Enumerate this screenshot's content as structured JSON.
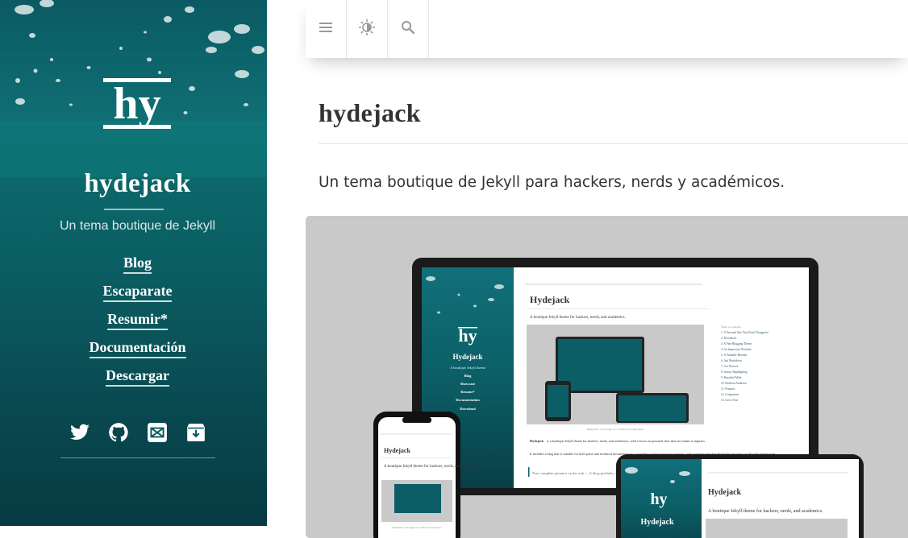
{
  "sidebar": {
    "logo_text": "hy",
    "title": "hydejack",
    "tagline": "Un tema boutique de Jekyll",
    "nav": [
      "Blog",
      "Escaparate",
      "Resumir*",
      "Documentación",
      "Descargar"
    ],
    "social_icons": [
      "twitter-icon",
      "github-icon",
      "email-icon",
      "download-icon"
    ]
  },
  "toolbar": {
    "icons": [
      "menu-icon",
      "theme-icon",
      "search-icon"
    ]
  },
  "main": {
    "title": "hydejack",
    "lead": "Un tema boutique de Jekyll para hackers, nerds y académicos."
  },
  "screenshot_mockup": {
    "laptop": {
      "sidebar_title": "Hydejack",
      "sidebar_tagline": "A boutique Jekyll theme",
      "sidebar_nav": [
        "Blog",
        "Showcase",
        "Resume*",
        "Documentation",
        "Download"
      ],
      "title": "Hydejack",
      "lead": "A boutique Jekyll theme for hackers, nerds, and academics.",
      "caption": "Hydejack's cover page on a variety of screen sizes.",
      "body_start": "Hydejack",
      "body_1": "is a boutique Jekyll theme for hackers, nerds, and academics, with a focus on personal sites that are meant to impress.",
      "body_2": "It includes a blog that is suitable for both prose and technical documentation, a portfolio to showcase your projects, and a resume template that looks amazing on the web and in print.",
      "quote": "Your complete presence on the web — A blog, portfolio, and resume.",
      "toc_heading": "Table of Contents",
      "toc": [
        "1. A Personal Site That Won't Disappoint",
        "2. Download",
        "3. A Fine Blogging Theme",
        "4. An Impressive Portfolio",
        "5. A Printable Resume",
        "6. Just Markdown",
        "7. Get Noticed",
        "8. Syntax Highlighting",
        "9. Beautiful Math",
        "10. Build an Audience",
        "11. Features",
        "12. Companion",
        "13. Get it Now"
      ]
    },
    "phone": {
      "title": "Hydejack",
      "lead": "A boutique Jekyll theme for hackers, nerds, and academics.",
      "caption": "Hydejack's cover page on a variety of screen sizes."
    },
    "tablet": {
      "sidebar_title": "Hydejack",
      "title": "Hydejack",
      "lead": "A boutique Jekyll theme for hackers, nerds, and academics."
    }
  },
  "colors": {
    "sidebar_teal": "#0c6a6c",
    "text": "#333333",
    "figure_bg": "#c9c9c9"
  }
}
